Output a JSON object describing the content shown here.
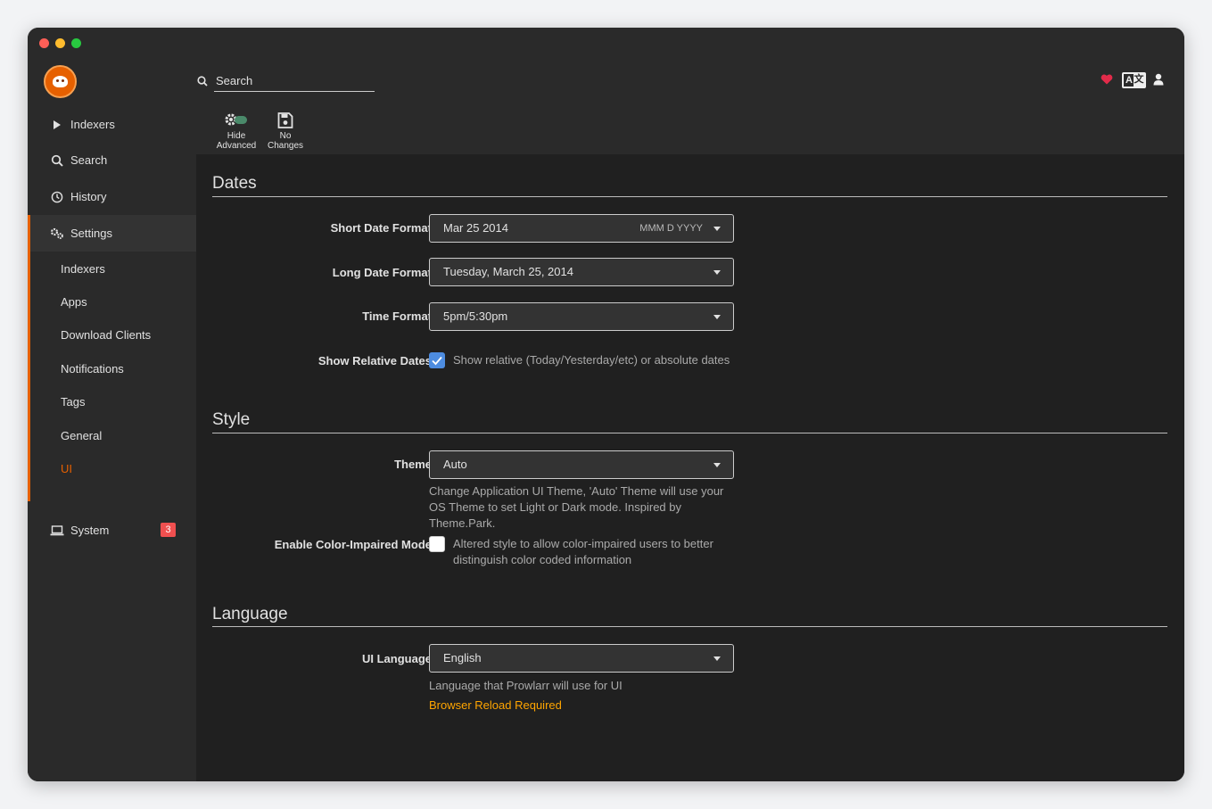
{
  "header": {
    "search_placeholder": "Search"
  },
  "sidebar": {
    "items": [
      {
        "label": "Indexers",
        "icon": "play-icon"
      },
      {
        "label": "Search",
        "icon": "search-icon"
      },
      {
        "label": "History",
        "icon": "clock-icon"
      },
      {
        "label": "Settings",
        "icon": "gears-icon"
      },
      {
        "label": "System",
        "icon": "laptop-icon"
      }
    ],
    "settings_sub": [
      "Indexers",
      "Apps",
      "Download Clients",
      "Notifications",
      "Tags",
      "General",
      "UI"
    ],
    "system_badge": "3"
  },
  "toolbar": {
    "hide_advanced_line1": "Hide",
    "hide_advanced_line2": "Advanced",
    "no_changes_line1": "No",
    "no_changes_line2": "Changes"
  },
  "dates": {
    "title": "Dates",
    "short_label": "Short Date Format",
    "short_value": "Mar 25 2014",
    "short_hint": "MMM D YYYY",
    "long_label": "Long Date Format",
    "long_value": "Tuesday, March 25, 2014",
    "time_label": "Time Format",
    "time_value": "5pm/5:30pm",
    "relative_label": "Show Relative Dates",
    "relative_text": "Show relative (Today/Yesterday/etc) or absolute dates"
  },
  "style": {
    "title": "Style",
    "theme_label": "Theme",
    "theme_value": "Auto",
    "theme_help": "Change Application UI Theme, 'Auto' Theme will use your OS Theme to set Light or Dark mode. Inspired by Theme.Park.",
    "color_label": "Enable Color-Impaired Mode",
    "color_text": "Altered style to allow color-impaired users to better distinguish color coded information"
  },
  "language": {
    "title": "Language",
    "ui_label": "UI Language",
    "ui_value": "English",
    "ui_help": "Language that Prowlarr will use for UI",
    "reload": "Browser Reload Required"
  },
  "colors": {
    "accent": "#e66000",
    "checkbox_on": "#4d8ce0",
    "badge": "#f05050",
    "warning": "#ffa500"
  }
}
